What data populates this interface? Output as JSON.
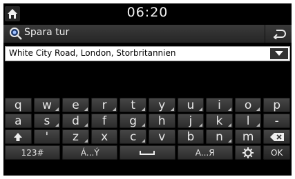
{
  "status": {
    "time": "06:20"
  },
  "header": {
    "title": "Spara tur"
  },
  "input": {
    "value": "White City Road, London, Storbritannien"
  },
  "keyboard": {
    "rows": [
      [
        "q",
        "w",
        "e",
        "r",
        "t",
        "y",
        "u",
        "i",
        "o",
        "p"
      ],
      [
        "a",
        "s",
        "d",
        "f",
        "g",
        "h",
        "j",
        "k",
        "l",
        "-"
      ],
      [
        "'",
        "z",
        "x",
        "c",
        "v",
        "b",
        "n",
        "m"
      ]
    ],
    "alt_keys": [
      "w",
      "e",
      "r",
      "t",
      "y",
      "u",
      "i",
      "o",
      "s",
      "d",
      "g",
      "j",
      "k",
      "l",
      "z",
      "c",
      "n"
    ],
    "bottom": {
      "numbers": "123#",
      "accents": "Á...Ý",
      "cyrillic": "A...Я",
      "ok": "OK"
    }
  }
}
